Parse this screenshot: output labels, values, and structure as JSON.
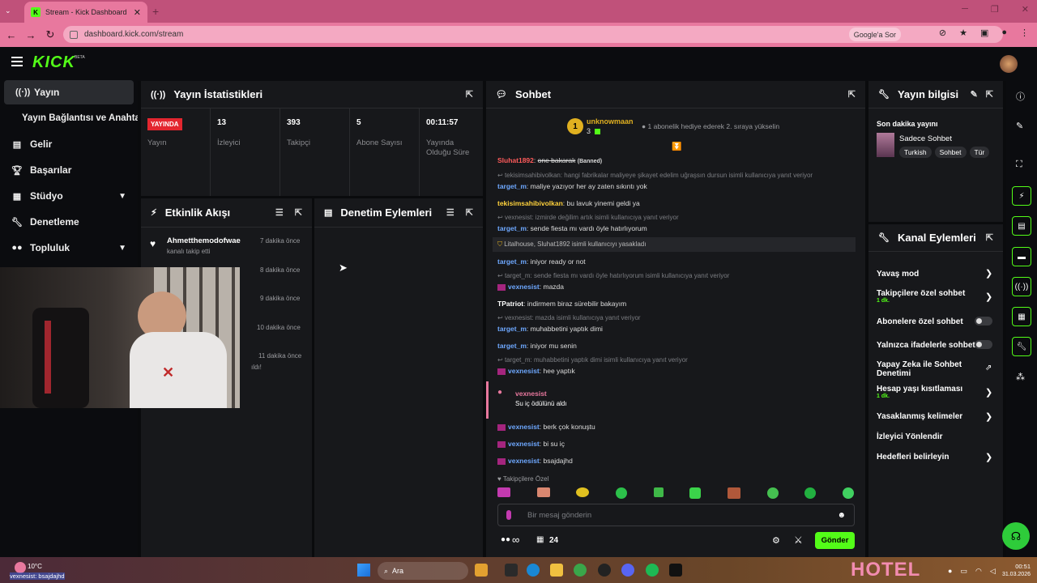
{
  "browser": {
    "tab_title": "Stream - Kick Dashboard",
    "url": "dashboard.kick.com/stream",
    "google_button": "Google'a Sor"
  },
  "brand": {
    "logo": "KICK",
    "beta": "BETA"
  },
  "sidebar": {
    "items": [
      {
        "label": "Yayın",
        "icon": "broadcast-icon"
      },
      {
        "label": "Yayın Bağlantısı ve Anahtarı",
        "icon": ""
      },
      {
        "label": "Gelir",
        "icon": "chart-icon"
      },
      {
        "label": "Başarılar",
        "icon": "trophy-icon"
      },
      {
        "label": "Stüdyo",
        "icon": "studio-icon"
      },
      {
        "label": "Denetleme",
        "icon": "wrench-icon"
      },
      {
        "label": "Topluluk",
        "icon": "community-icon"
      }
    ]
  },
  "stats": {
    "title": "Yayın İstatistikleri",
    "live_badge": "YAYINDA",
    "items": [
      {
        "value": "",
        "label": "Yayın"
      },
      {
        "value": "13",
        "label": "İzleyici"
      },
      {
        "value": "393",
        "label": "Takipçi"
      },
      {
        "value": "5",
        "label": "Abone Sayısı"
      },
      {
        "value": "00:11:57",
        "label": "Yayında Olduğu Süre"
      }
    ]
  },
  "activity": {
    "title": "Etkinlik Akışı",
    "user": "Ahmetthemodofwae",
    "action": "kanalı takip etti",
    "times": [
      "7 dakika önce",
      "8 dakika önce",
      "9 dakika önce",
      "10 dakika önce",
      "11 dakika önce"
    ],
    "partial": "ıldı!"
  },
  "moderation": {
    "title": "Denetim Eylemleri"
  },
  "chat": {
    "title": "Sohbet",
    "top_user": "unknowmaan",
    "top_count": "3",
    "gift_text": "1 abonelik hediye ederek 2. sıraya yükselin",
    "messages": [
      {
        "user": "Sluhat1892",
        "text": "one bakarak",
        "tag": "(Banned)"
      },
      {
        "sys": "tekisimsahibivolkan: hangi fabrikalar maliyeye şikayet edelim uğraşsın dursun isimli kullanıcıya yanıt veriyor",
        "user": "target_m",
        "text": "maliye yazıyor her ay zaten sıkıntı yok"
      },
      {
        "user": "tekisimsahibivolkan",
        "text": "bu lavuk yinemi geldi ya"
      },
      {
        "sys": "vexnesist: izmirde değilim artık isimli kullanıcıya yanıt veriyor",
        "user": "target_m",
        "text": "sende fiesta mı vardı öyle hatırlıyorum"
      },
      {
        "ban": "Litalhouse, Sluhat1892 isimli kullanıcıyı yasakladı"
      },
      {
        "user": "target_m",
        "text": "iniyor ready or not"
      },
      {
        "sys": "target_m: sende fiesta mı vardı öyle hatırlıyorum isimli kullanıcıya yanıt veriyor",
        "user": "vexnesist",
        "text": "mazda"
      },
      {
        "user": "TPatriot",
        "text": "indirmem biraz sürebilir bakayım"
      },
      {
        "sys": "vexnesist: mazda isimli kullanıcıya yanıt veriyor",
        "user": "target_m",
        "text": "muhabbetini yaptık dimi"
      },
      {
        "user": "target_m",
        "text": "iniyor mu senin"
      },
      {
        "sys": "target_m: muhabbetini yaptık dimi isimli kullanıcıya yanıt veriyor",
        "user": "vexnesist",
        "text": "hee yaptık"
      },
      {
        "reward_user": "vexnesist",
        "reward_text": "Su iç ödülünü aldı"
      },
      {
        "user": "vexnesist",
        "text": "berk çok konuştu"
      },
      {
        "user": "vexnesist",
        "text": "bi su iç"
      },
      {
        "user": "vexnesist",
        "text": "bsajdajhd"
      }
    ],
    "followers_only": "Takipçilere Özel",
    "input_placeholder": "Bir mesaj gönderin",
    "points": "24",
    "infinity": "∞",
    "send": "Gönder"
  },
  "stream_info": {
    "title": "Yayın bilgisi",
    "subtitle": "Son dakika yayını",
    "category": "Sadece Sohbet",
    "tags": [
      "Turkish",
      "Sohbet",
      "Tür"
    ]
  },
  "channel_actions": {
    "title": "Kanal Eylemleri",
    "items": [
      {
        "label": "Yavaş mod",
        "sub": "",
        "control": "arrow"
      },
      {
        "label": "Takipçilere özel sohbet",
        "sub": "1 dk.",
        "control": "arrow"
      },
      {
        "label": "Abonelere özel sohbet",
        "sub": "",
        "control": "toggle"
      },
      {
        "label": "Yalnızca ifadelerle sohbet",
        "sub": "",
        "control": "toggle"
      },
      {
        "label": "Yapay Zeka ile Sohbet Denetimi",
        "sub": "",
        "control": "external"
      },
      {
        "label": "Hesap yaşı kısıtlaması",
        "sub": "1 dk.",
        "control": "arrow"
      },
      {
        "label": "Yasaklanmış kelimeler",
        "sub": "",
        "control": "arrow"
      },
      {
        "label": "İzleyici Yönlendir",
        "sub": "",
        "control": "none"
      },
      {
        "label": "Hedefleri belirleyin",
        "sub": "",
        "control": "arrow"
      }
    ]
  },
  "overlay": {
    "text": "vexnesist: bsajdajhd"
  },
  "taskbar": {
    "weather": "10°C",
    "search": "Ara",
    "hotel": "HOTEL",
    "time": "00:51",
    "date": "31.03.2026"
  }
}
